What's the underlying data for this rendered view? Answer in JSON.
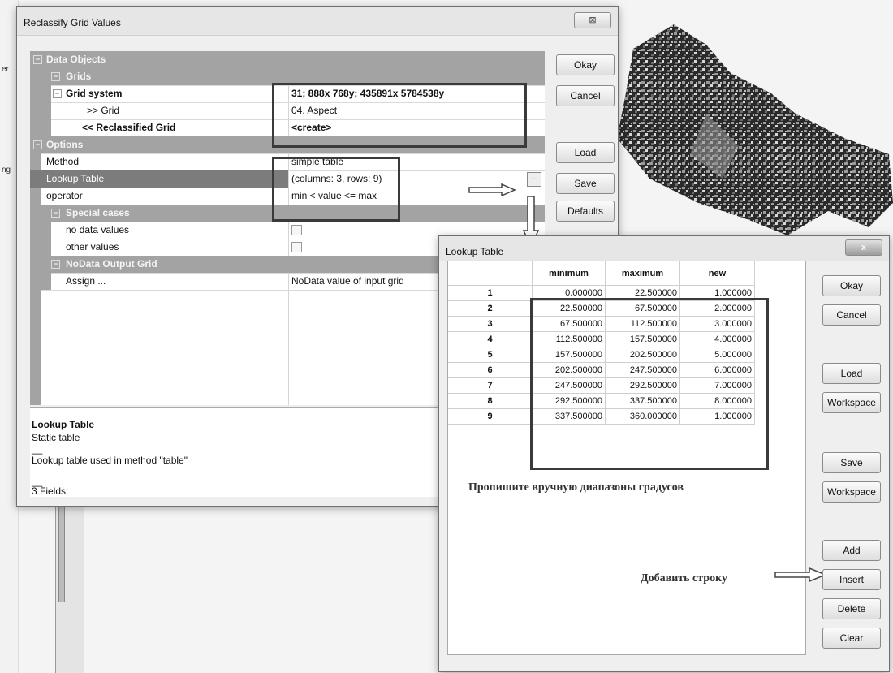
{
  "background": {
    "fragments": [
      "er",
      "ng"
    ]
  },
  "main_dialog": {
    "title": "Reclassify Grid Values",
    "close_glyph": "⊠",
    "buttons": [
      "Okay",
      "Cancel",
      "Load",
      "Save",
      "Defaults"
    ],
    "data_objects_header": "Data Objects",
    "grids_header": "Grids",
    "grid_system_label": "Grid system",
    "grid_system_value": "31; 888x 768y; 435891x 5784538y",
    "grid_label": ">> Grid",
    "grid_value": "04. Aspect",
    "reclassified_label": "<< Reclassified Grid",
    "reclassified_value": "<create>",
    "options_header": "Options",
    "method_label": "Method",
    "method_value": "simple table",
    "lookup_label": "Lookup Table",
    "lookup_value": " (columns: 3, rows: 9)",
    "lookup_button": "...",
    "operator_label": "operator",
    "operator_value": "min < value <= max",
    "special_header": "Special cases",
    "nodata_label": "no data values",
    "other_label": "other values",
    "nodata_output_header": "NoData Output Grid",
    "assign_label": "Assign ...",
    "assign_value": "NoData value of input grid",
    "desc_title": "Lookup Table",
    "desc_line1": "Static table",
    "desc_sep": "__",
    "desc_line2": "Lookup table used in method \"table\"",
    "desc_line3": "3 Fields:"
  },
  "lookup_dialog": {
    "title": "Lookup Table",
    "close_glyph": "x",
    "columns": [
      "minimum",
      "maximum",
      "new"
    ],
    "rows": [
      {
        "n": "1",
        "min": "0.000000",
        "max": "22.500000",
        "new": "1.000000"
      },
      {
        "n": "2",
        "min": "22.500000",
        "max": "67.500000",
        "new": "2.000000"
      },
      {
        "n": "3",
        "min": "67.500000",
        "max": "112.500000",
        "new": "3.000000"
      },
      {
        "n": "4",
        "min": "112.500000",
        "max": "157.500000",
        "new": "4.000000"
      },
      {
        "n": "5",
        "min": "157.500000",
        "max": "202.500000",
        "new": "5.000000"
      },
      {
        "n": "6",
        "min": "202.500000",
        "max": "247.500000",
        "new": "6.000000"
      },
      {
        "n": "7",
        "min": "247.500000",
        "max": "292.500000",
        "new": "7.000000"
      },
      {
        "n": "8",
        "min": "292.500000",
        "max": "337.500000",
        "new": "8.000000"
      },
      {
        "n": "9",
        "min": "337.500000",
        "max": "360.000000",
        "new": "1.000000"
      }
    ],
    "buttons": [
      "Okay",
      "Cancel",
      "Load",
      "Workspace",
      "Save",
      "Workspace",
      "Add",
      "Insert",
      "Delete",
      "Clear"
    ]
  },
  "annotations": {
    "ranges_note": "Пропишите вручную диапазоны градусов",
    "add_row_note": "Добавить строку"
  }
}
